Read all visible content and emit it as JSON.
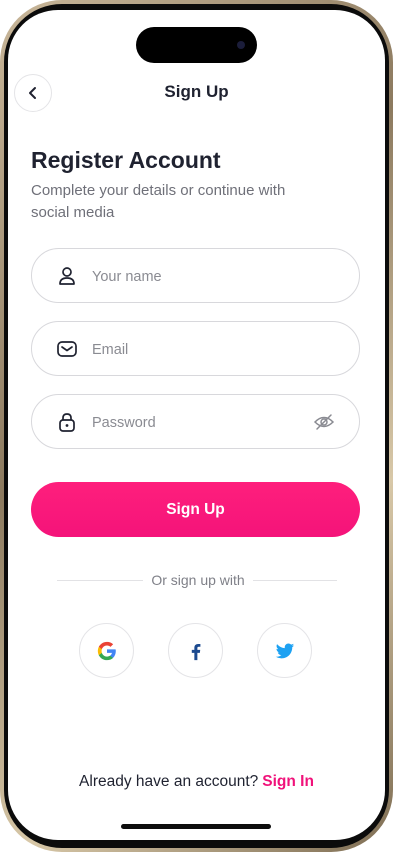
{
  "nav": {
    "title": "Sign Up",
    "back_icon": "chevron-left-icon"
  },
  "header": {
    "title": "Register Account",
    "subtitle": "Complete your details or continue with social media"
  },
  "form": {
    "name": {
      "placeholder": "Your name",
      "value": "",
      "icon": "user-icon"
    },
    "email": {
      "placeholder": "Email",
      "value": "",
      "icon": "mail-icon"
    },
    "password": {
      "placeholder": "Password",
      "value": "",
      "icon": "lock-icon",
      "toggle_icon": "eye-off-icon"
    },
    "submit_label": "Sign Up"
  },
  "social": {
    "divider_label": "Or sign up with",
    "providers": [
      {
        "name": "google",
        "icon": "google-icon"
      },
      {
        "name": "facebook",
        "icon": "facebook-icon"
      },
      {
        "name": "twitter",
        "icon": "twitter-icon"
      }
    ]
  },
  "footer": {
    "prompt": "Already have an account?",
    "link": "Sign In"
  },
  "colors": {
    "accent": "#f4137a",
    "text": "#1f2230",
    "muted": "#6f7079",
    "twitter": "#1da1f2",
    "facebook": "#1877f2"
  }
}
